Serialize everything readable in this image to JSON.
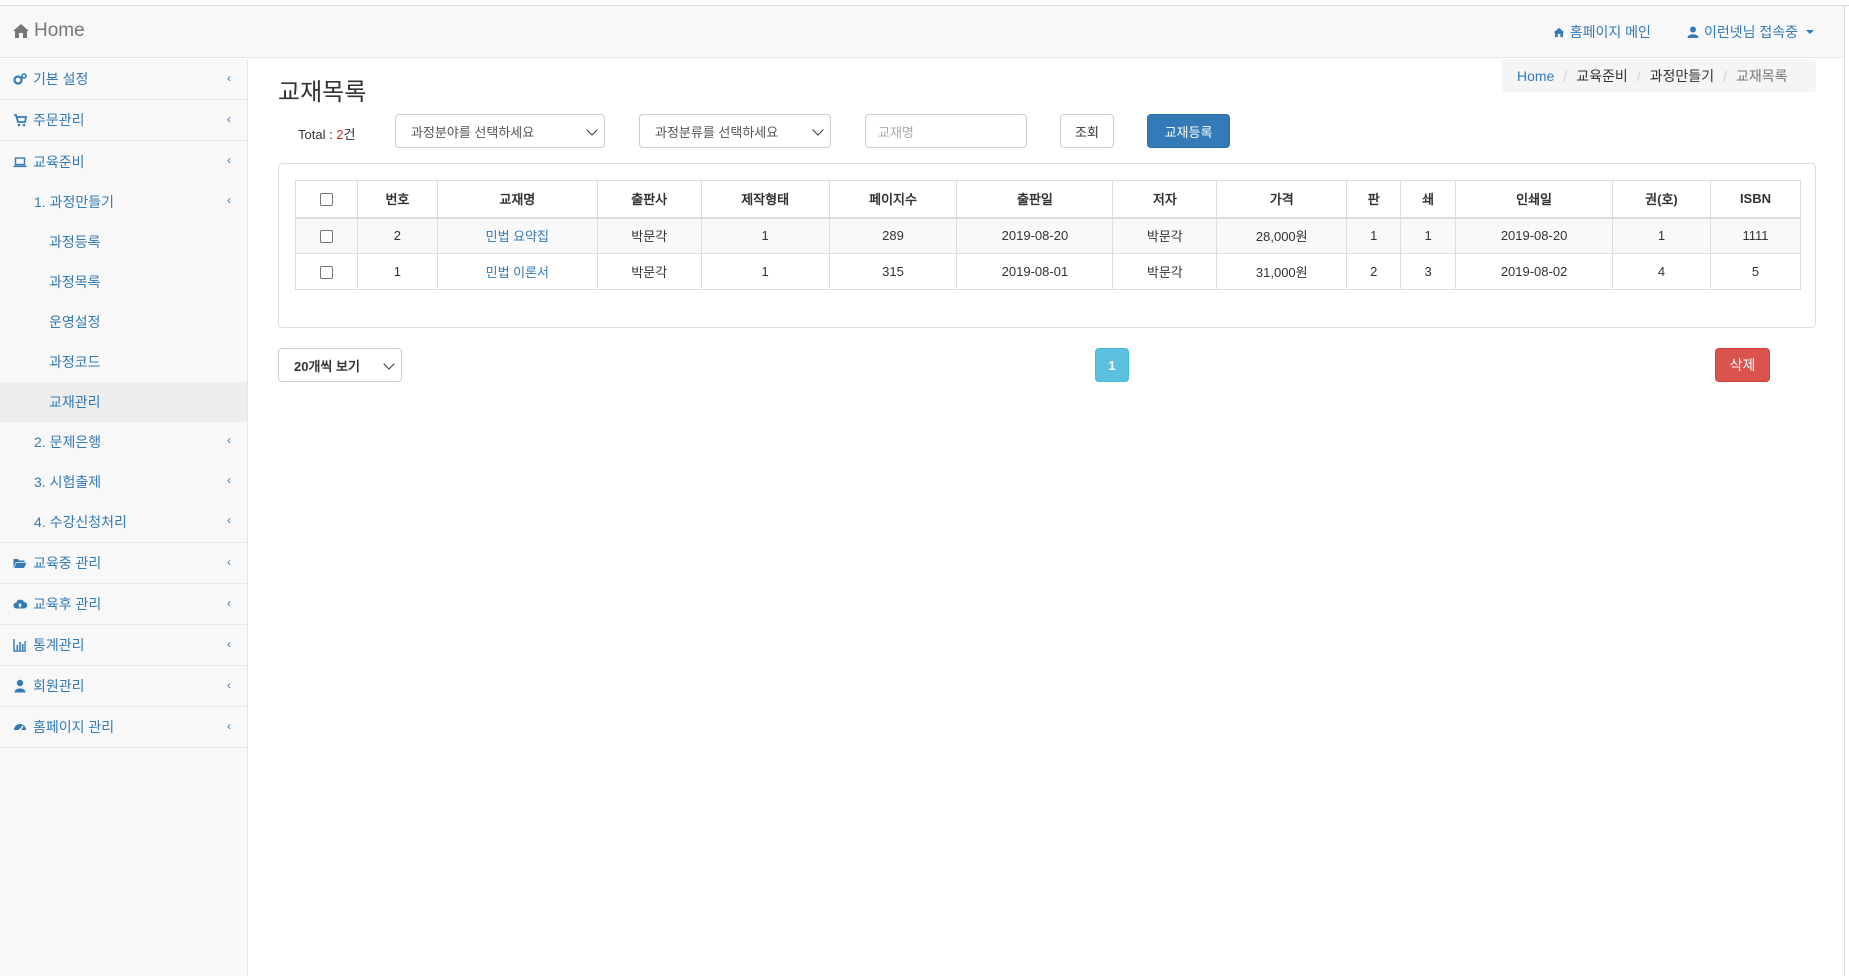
{
  "navbar": {
    "brand": "Home",
    "homepage_link": "홈페이지 메인",
    "user_menu": "이런넷님 접속중"
  },
  "sidebar": {
    "items": [
      {
        "label": "기본 설정",
        "icon": "cogs-icon"
      },
      {
        "label": "주문관리",
        "icon": "cart-icon"
      },
      {
        "label": "교육준비",
        "icon": "laptop-icon"
      }
    ],
    "edu_prep": {
      "step1": "1. 과정만들기",
      "step1_children": [
        "과정등록",
        "과정목록",
        "운영설정",
        "과정코드",
        "교재관리"
      ],
      "step2": "2. 문제은행",
      "step3": "3. 시험출제",
      "step4": "4. 수강신청처리"
    },
    "bottom_items": [
      {
        "label": "교육중 관리",
        "icon": "folder-open-icon"
      },
      {
        "label": "교육후 관리",
        "icon": "cloud-upload-icon"
      },
      {
        "label": "통계관리",
        "icon": "bar-chart-icon"
      },
      {
        "label": "회원관리",
        "icon": "user-icon"
      },
      {
        "label": "홈페이지 관리",
        "icon": "dashboard-icon"
      }
    ]
  },
  "page": {
    "title": "교재목록",
    "breadcrumb": [
      "Home",
      "교육준비",
      "과정만들기",
      "교재목록"
    ]
  },
  "toolbar": {
    "total_prefix": "Total : ",
    "total_count": "2",
    "total_suffix": "건",
    "field_select": "과정분야를 선택하세요",
    "category_select": "과정분류를 선택하세요",
    "search_placeholder": "교재명",
    "search_button": "조회",
    "register_button": "교재등록"
  },
  "table": {
    "headers": [
      "번호",
      "교재명",
      "출판사",
      "제작형태",
      "페이지수",
      "출판일",
      "저자",
      "가격",
      "판",
      "쇄",
      "인쇄일",
      "권(호)",
      "ISBN"
    ],
    "rows": [
      [
        "2",
        "민법 요약집",
        "박문각",
        "1",
        "289",
        "2019-08-20",
        "박문각",
        "28,000원",
        "1",
        "1",
        "2019-08-20",
        "1",
        "1111"
      ],
      [
        "1",
        "민법 이론서",
        "박문각",
        "1",
        "315",
        "2019-08-01",
        "박문각",
        "31,000원",
        "2",
        "3",
        "2019-08-02",
        "4",
        "5"
      ]
    ]
  },
  "footer": {
    "page_size": "20개씩 보기",
    "current_page": "1",
    "delete_button": "삭제"
  },
  "colors": {
    "link": "#337ab7",
    "primary": "#337ab7",
    "info": "#5bc0de",
    "danger": "#d9534f",
    "total_count": "#c9302c"
  }
}
